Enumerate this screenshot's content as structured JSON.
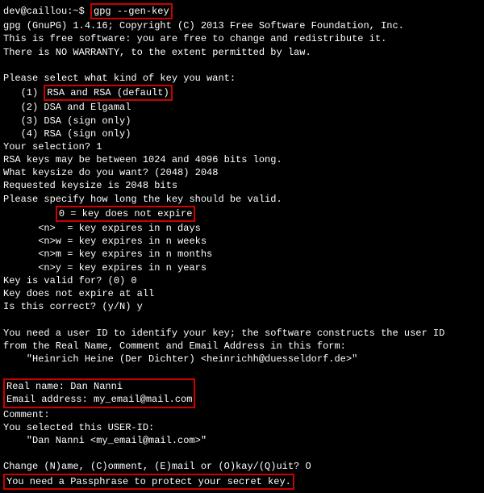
{
  "prompt": {
    "user_host": "dev@caillou",
    "path": ":~$ ",
    "command": "gpg --gen-key"
  },
  "header": {
    "line1": "gpg (GnuPG) 1.4.16; Copyright (C) 2013 Free Software Foundation, Inc.",
    "line2": "This is free software: you are free to change and redistribute it.",
    "line3": "There is NO WARRANTY, to the extent permitted by law."
  },
  "key_type": {
    "prompt": "Please select what kind of key you want:",
    "opt1_num": "   (1) ",
    "opt1_text": "RSA and RSA (default)",
    "opt2": "   (2) DSA and Elgamal",
    "opt3": "   (3) DSA (sign only)",
    "opt4": "   (4) RSA (sign only)",
    "selection": "Your selection? 1"
  },
  "keysize": {
    "range": "RSA keys may be between 1024 and 4096 bits long.",
    "ask": "What keysize do you want? (2048) 2048",
    "confirm": "Requested keysize is 2048 bits"
  },
  "expiry": {
    "prompt": "Please specify how long the key should be valid.",
    "opt0_pre": "         ",
    "opt0_text": "0 = key does not expire",
    "optn": "      <n>  = key expires in n days",
    "optnw": "      <n>w = key expires in n weeks",
    "optnm": "      <n>m = key expires in n months",
    "optny": "      <n>y = key expires in n years",
    "valid_for": "Key is valid for? (0) 0",
    "not_expire": "Key does not expire at all",
    "correct": "Is this correct? (y/N) y"
  },
  "userid": {
    "need1": "You need a user ID to identify your key; the software constructs the user ID",
    "need2": "from the Real Name, Comment and Email Address in this form:",
    "example": "    \"Heinrich Heine (Der Dichter) <heinrichh@duesseldorf.de>\"",
    "real_name": "Real name: Dan Nanni",
    "email": "Email address: my_email@mail.com",
    "comment": "Comment:",
    "selected_header": "You selected this USER-ID:",
    "selected_value": "    \"Dan Nanni <my_email@mail.com>\"",
    "change_prompt": "Change (N)ame, (C)omment, (E)mail or (O)kay/(Q)uit? O",
    "passphrase": "You need a Passphrase to protect your secret key."
  }
}
